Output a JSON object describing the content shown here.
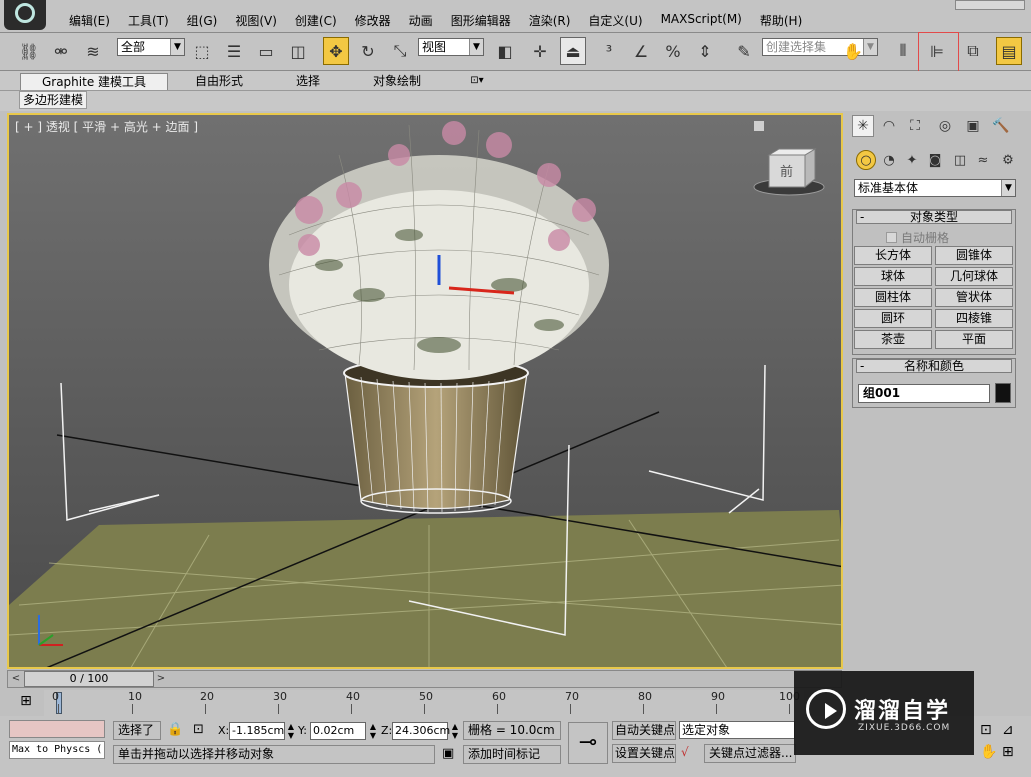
{
  "menubar": {
    "items": [
      "编辑(E)",
      "工具(T)",
      "组(G)",
      "视图(V)",
      "创建(C)",
      "修改器",
      "动画",
      "图形编辑器",
      "渲染(R)",
      "自定义(U)",
      "MAXScript(M)",
      "帮助(H)"
    ]
  },
  "toolbar": {
    "selection_filter": "全部",
    "ref_coord": "视图",
    "named_selection_placeholder": "创建选择集",
    "icons": [
      "link-icon",
      "unlink-icon",
      "bind-spacewarp-icon",
      "select-icon",
      "select-by-name-icon",
      "rect-region-icon",
      "window-crossing-icon",
      "move-icon",
      "rotate-icon",
      "scale-icon",
      "pivot-icon",
      "manipulate-icon",
      "keyboard-shortcut-icon",
      "snap-3d-icon",
      "angle-snap-icon",
      "percent-snap-icon",
      "spinner-snap-icon",
      "edit-named-sel-icon",
      "mirror-icon",
      "align-icon",
      "layer-manager-icon",
      "graphite-toggle-icon"
    ]
  },
  "ribbon": {
    "tabs": [
      "Graphite 建模工具",
      "自由形式",
      "选择",
      "对象绘制"
    ],
    "active_tab": "Graphite 建模工具",
    "sub_tab": "多边形建模"
  },
  "viewport": {
    "label": "[ + ] 透视 [ 平滑 + 高光 + 边面 ]",
    "viewcube_face": "前"
  },
  "command_panel": {
    "category_dropdown": "标准基本体",
    "object_type_title": "对象类型",
    "autogrid_label": "自动栅格",
    "object_buttons": [
      "长方体",
      "圆锥体",
      "球体",
      "几何球体",
      "圆柱体",
      "管状体",
      "圆环",
      "四棱锥",
      "茶壶",
      "平面"
    ],
    "name_color_title": "名称和颜色",
    "object_name": "组001",
    "object_color": "#111111"
  },
  "timeline": {
    "frame_display": "0 / 100",
    "ticks": [
      0,
      10,
      20,
      30,
      40,
      50,
      60,
      70,
      80,
      90,
      100
    ]
  },
  "status": {
    "maxscript_listener": "Max to Physcs (",
    "selected_label": "选择了",
    "x_label": "X:",
    "x_value": "-1.185cm",
    "y_label": "Y:",
    "y_value": "0.02cm",
    "z_label": "Z:",
    "z_value": "24.306cm",
    "grid_label": "栅格 = 10.0cm",
    "prompt": "单击并拖动以选择并移动对象",
    "add_time_tag": "添加时间标记",
    "auto_key": "自动关键点",
    "set_key": "设置关键点",
    "selected_object_drop": "选定对象",
    "key_filters": "关键点过滤器..."
  },
  "watermark": {
    "title": "溜溜自学",
    "subtitle": "ZIXUE.3D66.COM"
  }
}
